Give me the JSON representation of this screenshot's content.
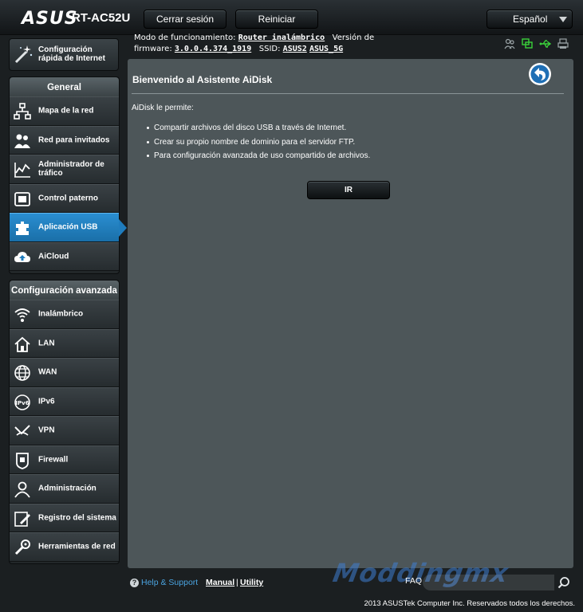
{
  "header": {
    "logo": "ASUS",
    "model": "RT-AC52U",
    "logout_label": "Cerrar sesión",
    "reboot_label": "Reiniciar",
    "language": "Español"
  },
  "info": {
    "mode_label": "Modo de funcionamiento:",
    "mode_value": "Router inalámbrico",
    "version_label": "Versión de",
    "firmware_label": "firmware:",
    "firmware_value": "3.0.0.4.374_1919",
    "ssid_label": "SSID:",
    "ssid_1": "ASUS2",
    "ssid_2": "ASUS_5G",
    "status_icons": [
      "clients-icon",
      "network-status-icon",
      "usb-icon",
      "printer-icon"
    ]
  },
  "sidebar": {
    "quick_setup": "Configuración rápida de Internet",
    "general_title": "General",
    "general_items": [
      {
        "label": "Mapa de la red",
        "icon": "network-map-icon"
      },
      {
        "label": "Red para invitados",
        "icon": "guest-network-icon"
      },
      {
        "label": "Administrador de tráfico",
        "icon": "traffic-manager-icon"
      },
      {
        "label": "Control paterno",
        "icon": "parental-control-icon"
      },
      {
        "label": "Aplicación USB",
        "icon": "usb-application-icon",
        "active": true
      },
      {
        "label": "AiCloud",
        "icon": "aicloud-icon"
      }
    ],
    "advanced_title": "Configuración avanzada",
    "advanced_items": [
      {
        "label": "Inalámbrico",
        "icon": "wireless-icon"
      },
      {
        "label": "LAN",
        "icon": "lan-icon"
      },
      {
        "label": "WAN",
        "icon": "wan-icon"
      },
      {
        "label": "IPv6",
        "icon": "ipv6-icon"
      },
      {
        "label": "VPN",
        "icon": "vpn-icon"
      },
      {
        "label": "Firewall",
        "icon": "firewall-icon"
      },
      {
        "label": "Administración",
        "icon": "administration-icon"
      },
      {
        "label": "Registro del sistema",
        "icon": "system-log-icon"
      },
      {
        "label": "Herramientas de red",
        "icon": "network-tools-icon"
      }
    ]
  },
  "main": {
    "title": "Bienvenido al Asistente AiDisk",
    "intro": "AiDisk le permite:",
    "bullets": [
      "Compartir archivos del disco USB a través de Internet.",
      "Crear su propio nombre de dominio para el servidor FTP.",
      "Para configuración avanzada de uso compartido de archivos."
    ],
    "go_label": "IR"
  },
  "footer": {
    "help_label": "Help & Support",
    "manual_label": "Manual",
    "separator": "|",
    "utility_label": "Utility",
    "faq_label": "FAQ",
    "watermark": "Moddingmx",
    "copyright": "2013 ASUSTek Computer Inc. Reservados todos los derechos."
  },
  "colors": {
    "accent": "#1f7cbd",
    "link": "#4aa3df",
    "content_bg": "#4d5659",
    "status_green": "#3ad13a"
  }
}
